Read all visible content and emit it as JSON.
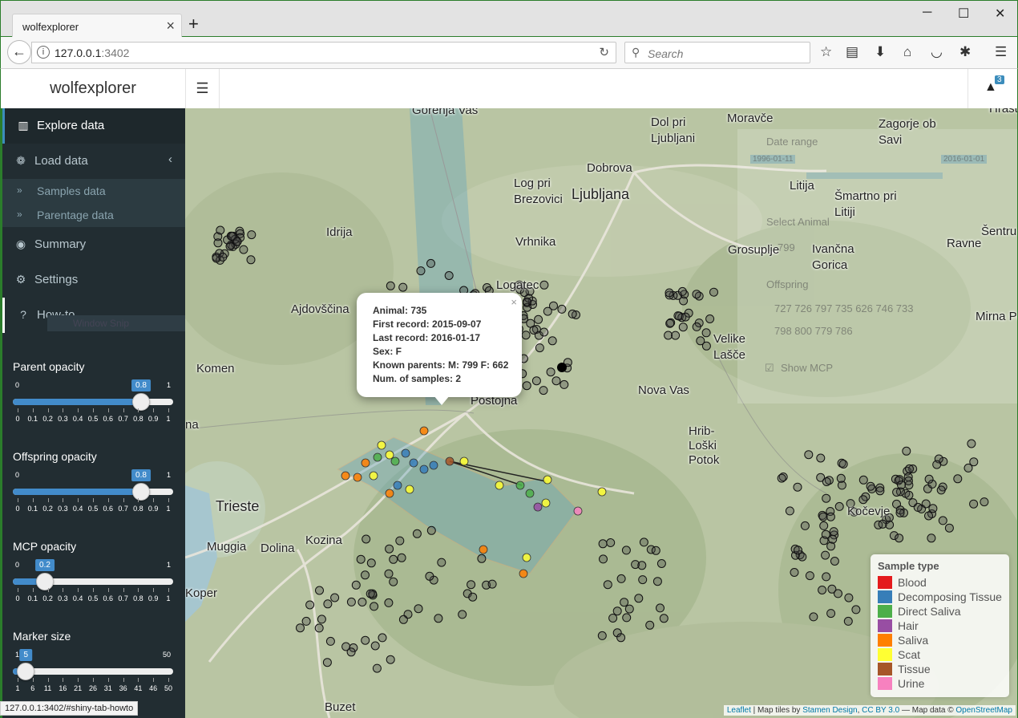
{
  "browser": {
    "tab_title": "wolfexplorer",
    "tab_close": "×",
    "new_tab": "+",
    "url_host": "127.0.0.1",
    "url_port": ":3402",
    "search_placeholder": "Search",
    "status_url": "127.0.0.1:3402/#shiny-tab-howto"
  },
  "app": {
    "title": "wolfexplorer",
    "notification_count": "3"
  },
  "sidebar": {
    "items": [
      {
        "label": "Explore data",
        "icon": "map-icon"
      },
      {
        "label": "Load data",
        "icon": "paw-icon"
      },
      {
        "label": "Summary",
        "icon": "eye-icon"
      },
      {
        "label": "Settings",
        "icon": "gears-icon"
      },
      {
        "label": "How-to",
        "icon": "question-icon"
      }
    ],
    "subitems": [
      {
        "label": "Samples data"
      },
      {
        "label": "Parentage data"
      }
    ],
    "window_snip": "Window Snip"
  },
  "sliders": [
    {
      "label": "Parent opacity",
      "min": "0",
      "max": "1",
      "value": "0.8",
      "fraction": 0.8,
      "ticks": [
        "0",
        "0.1",
        "0.2",
        "0.3",
        "0.4",
        "0.5",
        "0.6",
        "0.7",
        "0.8",
        "0.9",
        "1"
      ]
    },
    {
      "label": "Offspring opacity",
      "min": "0",
      "max": "1",
      "value": "0.8",
      "fraction": 0.8,
      "ticks": [
        "0",
        "0.1",
        "0.2",
        "0.3",
        "0.4",
        "0.5",
        "0.6",
        "0.7",
        "0.8",
        "0.9",
        "1"
      ]
    },
    {
      "label": "MCP opacity",
      "min": "0",
      "max": "1",
      "value": "0.2",
      "fraction": 0.2,
      "ticks": [
        "0",
        "0.1",
        "0.2",
        "0.3",
        "0.4",
        "0.5",
        "0.6",
        "0.7",
        "0.8",
        "0.9",
        "1"
      ]
    },
    {
      "label": "Marker size",
      "min": "1",
      "max": "50",
      "value": "5",
      "fraction": 0.0816,
      "ticks": [
        "1",
        "6",
        "11",
        "16",
        "21",
        "26",
        "31",
        "36",
        "41",
        "46",
        "50"
      ]
    }
  ],
  "map": {
    "places": [
      "Gorenja Vas",
      "Moravče",
      "Dol pri Ljubljani",
      "Zagorje ob Savi",
      "Hrastnik",
      "Dobrova",
      "Log pri Brezovici",
      "Ljubljana",
      "Litija",
      "Šmartno pri Litiji",
      "Idrija",
      "Vrhnika",
      "Grosuplje",
      "Ivančna Gorica",
      "Ravne",
      "Šentru",
      "Logatec",
      "Ajdovščina",
      "Velike Lašče",
      "Mirna Peč",
      "Komen",
      "Postojna",
      "Nova Vas",
      "Hrib-Loški Potok",
      "Trieste",
      "Kočevje",
      "Muggia",
      "Dolina",
      "Kozina",
      "Koper",
      "Buzet",
      "na"
    ],
    "popup": {
      "close": "×",
      "animal": "Animal: 735",
      "first": "First record: 2015-09-07",
      "last": "Last record: 2016-01-17",
      "sex": "Sex: F",
      "parents": "Known parents: M: 799 F: 662",
      "samples": "Num. of samples: 2"
    },
    "controls": {
      "date_range": "Date range",
      "date_start": "1996-01-11",
      "date_end": "2016-01-01",
      "select_animal": "Select Animal",
      "animal_value": "799",
      "offspring": "Offspring",
      "offspring_ids_1": "727  726  797  735  626  746  733",
      "offspring_ids_2": "798  800  779  786",
      "show_mcp": "Show MCP"
    },
    "legend": {
      "title": "Sample type",
      "items": [
        {
          "label": "Blood",
          "color": "#e41a1c"
        },
        {
          "label": "Decomposing Tissue",
          "color": "#377eb8"
        },
        {
          "label": "Direct Saliva",
          "color": "#4daf4a"
        },
        {
          "label": "Hair",
          "color": "#984ea3"
        },
        {
          "label": "Saliva",
          "color": "#ff7f00"
        },
        {
          "label": "Scat",
          "color": "#ffff33"
        },
        {
          "label": "Tissue",
          "color": "#a65628"
        },
        {
          "label": "Urine",
          "color": "#f781bf"
        }
      ]
    },
    "attribution": {
      "leaflet": "Leaflet",
      "sep1": " | Map tiles by ",
      "stamen": "Stamen Design",
      "comma": ", ",
      "ccby": "CC BY 3.0",
      "mid": " — Map data © ",
      "osm": "OpenStreetMap"
    }
  }
}
